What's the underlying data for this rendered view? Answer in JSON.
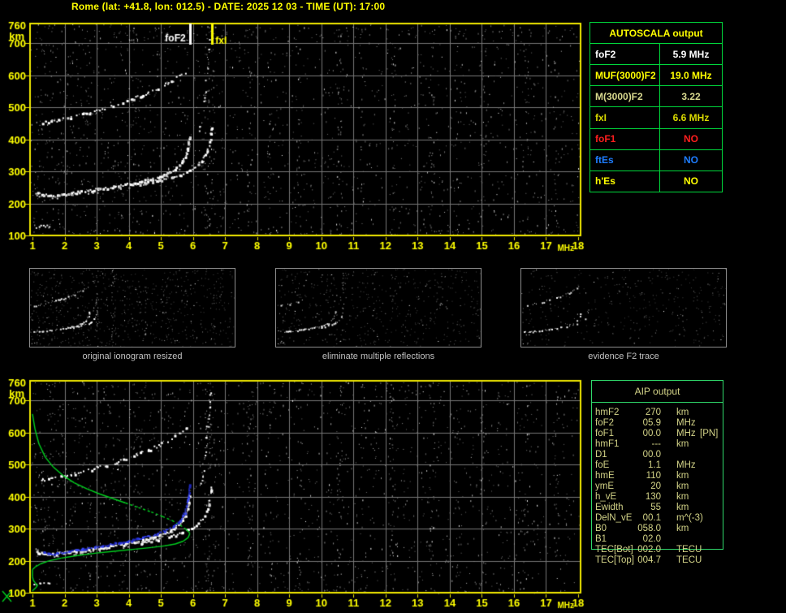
{
  "title": "Rome (lat: +41.8, lon: 012.5) - DATE: 2025 12 03 - TIME (UT): 17:00",
  "colors": {
    "background": "#000000",
    "title_text": "#ffff00",
    "plot_border": "#f0e800",
    "grid": "#767676",
    "axis_labels": "#ffff00",
    "table_border_green": "#00d83c",
    "aip_text": "#d4d488",
    "caption_gray": "#c2c2c2",
    "profile_green": "#00d01e",
    "autoscaled_blue": "#2c38e8",
    "trace_white": "#ffffff"
  },
  "autoscala_table": {
    "header": "AUTOSCALA output",
    "rows": [
      {
        "label": "foF2",
        "value": "5.9 MHz",
        "color": "#ffffff"
      },
      {
        "label": "MUF(3000)F2",
        "value": "19.0 MHz",
        "color": "#ffff00"
      },
      {
        "label": "M(3000)F2",
        "value": "3.22",
        "color": "#d8d88e"
      },
      {
        "label": "fxI",
        "value": "6.6 MHz",
        "color": "#d9d900"
      },
      {
        "label": "foF1",
        "value": "NO",
        "color": "#ff1e1e"
      },
      {
        "label": "ftEs",
        "value": "NO",
        "color": "#1e7dff"
      },
      {
        "label": "h'Es",
        "value": "NO",
        "color": "#ffff00"
      }
    ]
  },
  "aip_table": {
    "header": "AIP output",
    "rows": [
      {
        "label": "hmF2",
        "value": "270",
        "unit": "km",
        "note": ""
      },
      {
        "label": "foF2",
        "value": "05.9",
        "unit": "MHz",
        "note": ""
      },
      {
        "label": "foF1",
        "value": "00.0",
        "unit": "MHz",
        "note": "[PN]"
      },
      {
        "label": "hmF1",
        "value": "---",
        "unit": "km",
        "note": ""
      },
      {
        "label": "D1",
        "value": "00.0",
        "unit": "",
        "note": ""
      },
      {
        "label": "foE",
        "value": "1.1",
        "unit": "MHz",
        "note": ""
      },
      {
        "label": "hmE",
        "value": "110",
        "unit": "km",
        "note": ""
      },
      {
        "label": "ymE",
        "value": "20",
        "unit": "km",
        "note": ""
      },
      {
        "label": "h_vE",
        "value": "130",
        "unit": "km",
        "note": ""
      },
      {
        "label": "Ewidth",
        "value": "55",
        "unit": "km",
        "note": ""
      },
      {
        "label": "DelN_vE",
        "value": "00.1",
        "unit": "m^(-3)",
        "note": ""
      },
      {
        "label": "B0",
        "value": "058.0",
        "unit": "km",
        "note": ""
      },
      {
        "label": "B1",
        "value": "02.0",
        "unit": "",
        "note": ""
      },
      {
        "label": "TEC[Bot]",
        "value": "002.0",
        "unit": "TECU",
        "note": ""
      },
      {
        "label": "TEC[Top]",
        "value": "004.7",
        "unit": "TECU",
        "note": ""
      }
    ]
  },
  "thumbnails": [
    {
      "caption": "original ionogram resized"
    },
    {
      "caption": "eliminate multiple reflections"
    },
    {
      "caption": "evidence F2 trace"
    }
  ],
  "chart_data": {
    "type": "scatter",
    "description": "Vertical-incidence ionogram (virtual height km vs frequency MHz), shown twice: top with autoscaled foF2/fxI markers, bottom with restored F2 trace (blue) and electron density profile (green)",
    "xlabel": "MHz",
    "ylabel": "km",
    "xlim": [
      1,
      18
    ],
    "ylim": [
      100,
      760
    ],
    "xticks": [
      1,
      2,
      3,
      4,
      5,
      6,
      7,
      8,
      9,
      10,
      11,
      12,
      13,
      14,
      15,
      16,
      17,
      18
    ],
    "yticks": [
      760,
      700,
      600,
      500,
      400,
      300,
      200,
      100
    ],
    "grid": true,
    "markers": {
      "foF2": {
        "freq": 5.9,
        "label": "foF2",
        "color": "#ffffff"
      },
      "fxI": {
        "freq": 6.6,
        "label": "fxI",
        "color": "#ffff00"
      }
    },
    "traces": {
      "f2_ordinary": [
        [
          1.1,
          233
        ],
        [
          1.35,
          229
        ],
        [
          1.6,
          227
        ],
        [
          1.85,
          230
        ],
        [
          2.1,
          233
        ],
        [
          2.4,
          237
        ],
        [
          2.7,
          241
        ],
        [
          3.0,
          246
        ],
        [
          3.3,
          250
        ],
        [
          3.6,
          255
        ],
        [
          3.9,
          260
        ],
        [
          4.2,
          266
        ],
        [
          4.5,
          273
        ],
        [
          4.8,
          281
        ],
        [
          5.05,
          290
        ],
        [
          5.25,
          299
        ],
        [
          5.4,
          308
        ],
        [
          5.55,
          320
        ],
        [
          5.65,
          333
        ],
        [
          5.73,
          347
        ],
        [
          5.79,
          363
        ],
        [
          5.83,
          381
        ],
        [
          5.86,
          400
        ],
        [
          5.88,
          418
        ]
      ],
      "f2_extraordinary": [
        [
          4.35,
          263
        ],
        [
          4.65,
          268
        ],
        [
          4.95,
          274
        ],
        [
          5.25,
          281
        ],
        [
          5.55,
          290
        ],
        [
          5.8,
          300
        ],
        [
          6.0,
          311
        ],
        [
          6.15,
          323
        ],
        [
          6.28,
          337
        ],
        [
          6.38,
          353
        ],
        [
          6.45,
          371
        ],
        [
          6.5,
          390
        ],
        [
          6.53,
          410
        ],
        [
          6.55,
          428
        ],
        [
          6.56,
          445
        ]
      ],
      "x_tail": [
        [
          6.2,
          430
        ],
        [
          6.28,
          470
        ],
        [
          6.33,
          510
        ],
        [
          6.38,
          555
        ],
        [
          6.42,
          600
        ],
        [
          6.46,
          650
        ],
        [
          6.5,
          700
        ],
        [
          6.53,
          745
        ]
      ],
      "second_hop": [
        [
          1.25,
          452
        ],
        [
          1.55,
          457
        ],
        [
          1.85,
          463
        ],
        [
          2.15,
          470
        ],
        [
          2.45,
          478
        ],
        [
          2.75,
          486
        ],
        [
          3.05,
          494
        ],
        [
          3.35,
          503
        ],
        [
          3.7,
          513
        ],
        [
          4.1,
          527
        ],
        [
          4.5,
          543
        ],
        [
          4.9,
          561
        ],
        [
          5.3,
          582
        ],
        [
          5.6,
          600
        ],
        [
          5.85,
          618
        ]
      ],
      "e_layer": [
        [
          1.05,
          127
        ],
        [
          1.25,
          131
        ],
        [
          1.45,
          132
        ],
        [
          1.6,
          130
        ]
      ]
    },
    "bottom_overlays": {
      "autoscaled_trace": [
        [
          1.35,
          231
        ],
        [
          1.5,
          224
        ],
        [
          1.65,
          222
        ],
        [
          1.85,
          226
        ],
        [
          2.05,
          230
        ],
        [
          2.3,
          234
        ],
        [
          2.55,
          239
        ],
        [
          2.8,
          243
        ],
        [
          3.05,
          247
        ],
        [
          3.3,
          251
        ],
        [
          3.55,
          256
        ],
        [
          3.8,
          260
        ],
        [
          4.05,
          265
        ],
        [
          4.3,
          271
        ],
        [
          4.55,
          277
        ],
        [
          4.8,
          284
        ],
        [
          5.0,
          291
        ],
        [
          5.2,
          299
        ],
        [
          5.35,
          308
        ],
        [
          5.5,
          319
        ],
        [
          5.6,
          330
        ],
        [
          5.68,
          343
        ],
        [
          5.74,
          357
        ],
        [
          5.79,
          372
        ],
        [
          5.82,
          389
        ],
        [
          5.85,
          408
        ],
        [
          5.87,
          428
        ],
        [
          5.88,
          442
        ]
      ],
      "density_profile": [
        [
          1.0,
          658
        ],
        [
          1.08,
          610
        ],
        [
          1.2,
          565
        ],
        [
          1.4,
          523
        ],
        [
          1.65,
          492
        ],
        [
          1.95,
          466
        ],
        [
          2.3,
          443
        ],
        [
          2.7,
          424
        ],
        [
          3.1,
          408
        ],
        [
          3.5,
          394
        ],
        [
          3.9,
          380
        ],
        [
          4.3,
          366
        ],
        [
          4.7,
          352
        ],
        [
          5.05,
          338
        ],
        [
          5.35,
          325
        ],
        [
          5.6,
          311
        ],
        [
          5.78,
          298
        ],
        [
          5.88,
          289
        ],
        [
          5.9,
          284
        ],
        [
          5.85,
          272
        ],
        [
          5.7,
          261
        ],
        [
          5.45,
          252
        ],
        [
          5.1,
          246
        ],
        [
          4.7,
          241
        ],
        [
          4.2,
          236
        ],
        [
          3.6,
          230
        ],
        [
          3.0,
          224
        ],
        [
          2.4,
          216
        ],
        [
          1.9,
          208
        ],
        [
          1.5,
          199
        ],
        [
          1.25,
          190
        ],
        [
          1.08,
          180
        ],
        [
          1.0,
          172
        ],
        [
          1.0,
          150
        ],
        [
          1.03,
          138
        ],
        [
          1.1,
          129
        ],
        [
          1.16,
          123
        ],
        [
          1.1,
          115
        ],
        [
          1.03,
          109
        ],
        [
          1.0,
          105
        ]
      ]
    },
    "noise_columns": [
      [
        6.45,
        45
      ],
      [
        6.6,
        25
      ],
      [
        7.75,
        30
      ],
      [
        8.4,
        18
      ],
      [
        9.3,
        18
      ],
      [
        10.55,
        35
      ],
      [
        11.3,
        15
      ],
      [
        12.2,
        30
      ],
      [
        13.45,
        28
      ],
      [
        14.2,
        15
      ],
      [
        15.05,
        22
      ],
      [
        16.35,
        25
      ],
      [
        17.3,
        20
      ],
      [
        5.15,
        15
      ],
      [
        4.2,
        12
      ]
    ]
  }
}
